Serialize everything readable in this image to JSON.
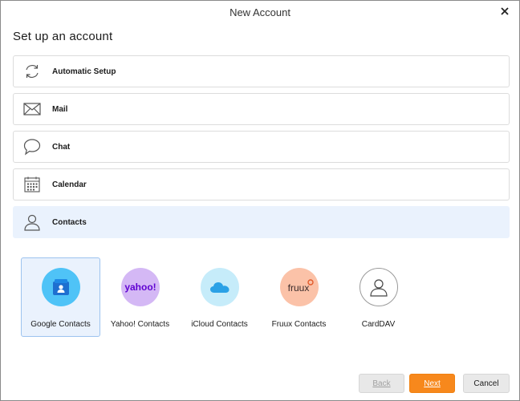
{
  "window": {
    "title": "New Account",
    "close_icon": "close-icon"
  },
  "heading": "Set up an account",
  "options": [
    {
      "label": "Automatic Setup",
      "icon": "sync-icon",
      "selected": false
    },
    {
      "label": "Mail",
      "icon": "envelope-icon",
      "selected": false
    },
    {
      "label": "Chat",
      "icon": "chat-bubble-icon",
      "selected": false
    },
    {
      "label": "Calendar",
      "icon": "calendar-icon",
      "selected": false
    },
    {
      "label": "Contacts",
      "icon": "person-icon",
      "selected": true
    }
  ],
  "providers": [
    {
      "label": "Google Contacts",
      "icon": "google-contacts-icon",
      "color": "#4fc3f7",
      "selected": true
    },
    {
      "label": "Yahoo! Contacts",
      "icon": "yahoo-logo",
      "color": "#d4b8f5",
      "selected": false,
      "logo_text": "yahoo!"
    },
    {
      "label": "iCloud Contacts",
      "icon": "icloud-icon",
      "color": "#c6ecfa",
      "selected": false
    },
    {
      "label": "Fruux Contacts",
      "icon": "fruux-logo",
      "color": "#fbc2a8",
      "selected": false,
      "logo_text": "fruux"
    },
    {
      "label": "CardDAV",
      "icon": "carddav-person-icon",
      "color": "#ffffff",
      "selected": false
    }
  ],
  "buttons": {
    "back": "Back",
    "next": "Next",
    "cancel": "Cancel"
  },
  "colors": {
    "selected_bg": "#eaf2fd",
    "next_button": "#f7881c"
  }
}
